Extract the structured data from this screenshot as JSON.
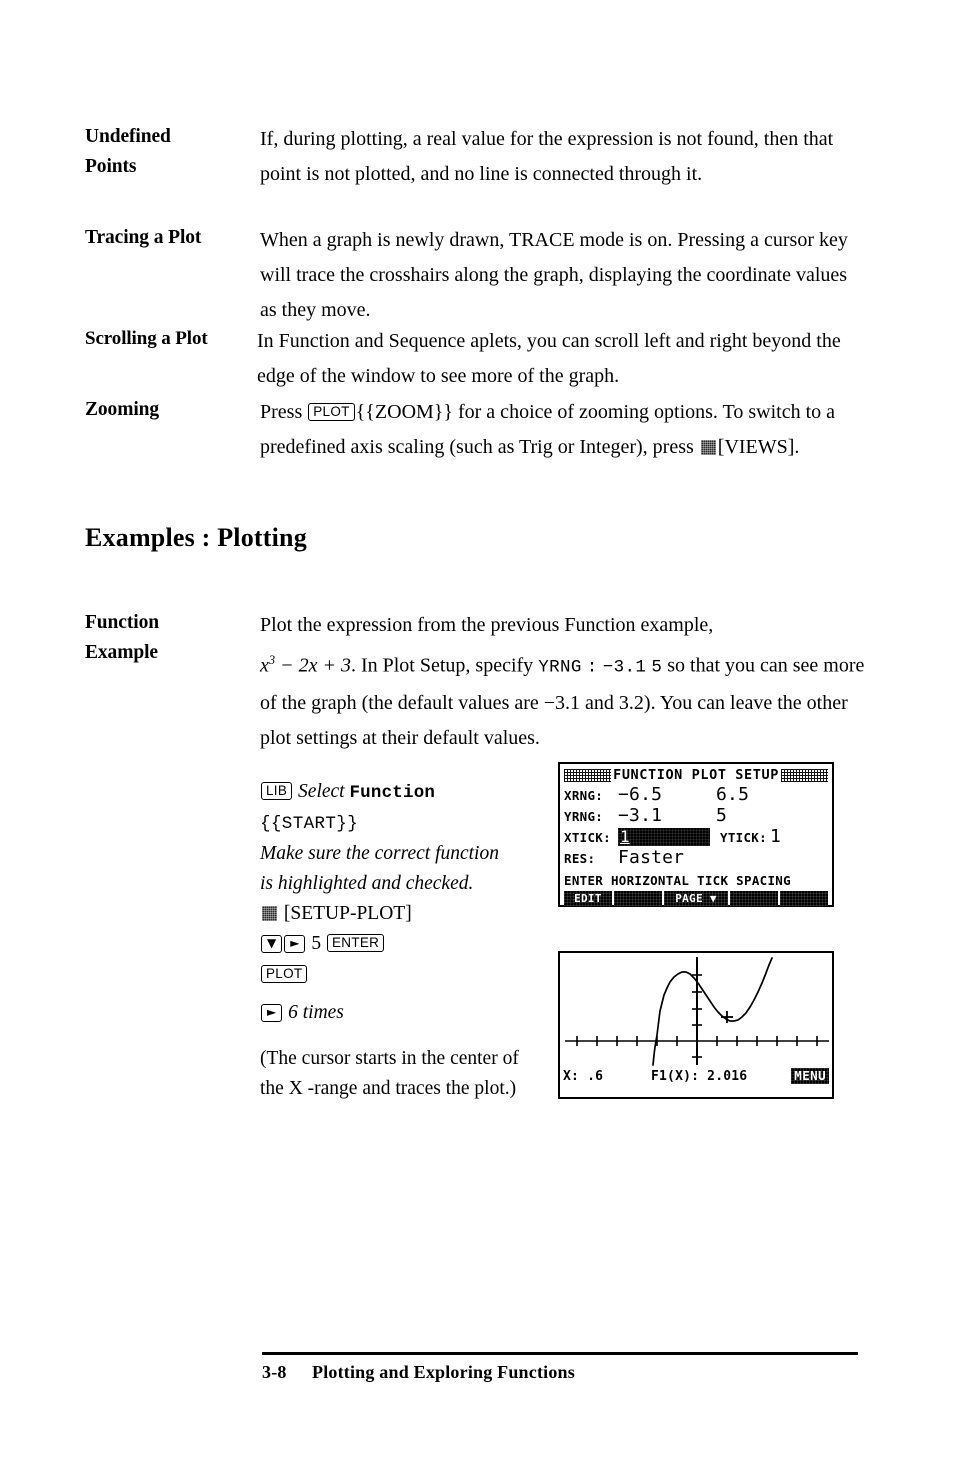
{
  "sections": [
    {
      "term_line1": "Undefined",
      "term_line2": "Points",
      "body": "If, during plotting, a real value for the expression is not found, then that point is not plotted, and no line is connected through it."
    },
    {
      "term_line1": "Tracing a Plot",
      "term_line2": "",
      "body": "When a graph is newly drawn, TRACE mode is on. Pressing a cursor key will trace the crosshairs along the graph, displaying the coordinate values as they move."
    },
    {
      "term_line1": "Scrolling a Plot",
      "term_line2": "",
      "body": "In Function and Sequence aplets, you can scroll left and right beyond the edge of the window to see more of the graph."
    }
  ],
  "zooming": {
    "term": "Zooming",
    "text_1": "Press",
    "key_plot": "PLOT",
    "text_2": "{{ZOOM}} for a choice of zooming options. To switch to a predefined axis scaling (such as Trig or Integer), press",
    "shift_key_icon": "shift-key",
    "key_views": "[VIEWS]",
    "text_3": "."
  },
  "heading": "Examples : Plotting",
  "function_example": {
    "term_line1": "Function",
    "term_line2": "Example",
    "text_1": "Plot the expression from the previous Function example,",
    "expr_base": "x",
    "expr_exponent": "3",
    "expr_rest": "− 2x + 3",
    "text_2": ". In Plot Setup, specify",
    "mono_yrng": "YRNG",
    "mono_colon": ":",
    "mono_low": "−3.1",
    "mono_high": "5",
    "text_so": "so",
    "text_3": "that you can see more of the graph (the default values are −3.1 and 3.2). You can leave the other plot settings at their default values."
  },
  "keysteps": {
    "line1_key": "LIB",
    "line1_italic": "Select",
    "line1_mono": "Function",
    "line2_mono": "{{START}}",
    "line3_italic": "Make sure the correct function",
    "line4_italic": "is highlighted and checked.",
    "line5_shift": "shift-key",
    "line5_label": "[SETUP-PLOT]",
    "line6_down": "▼",
    "line6_right": "►",
    "line6_digit": "5",
    "line6_enter": "ENTER"
  },
  "keysteps2": {
    "line1_key": "PLOT",
    "line2_right": "►",
    "line2_italic": "6 times",
    "note": "(The cursor starts in the center of the X -range and traces the plot.)"
  },
  "lcd_setup": {
    "title": "FUNCTION PLOT SETUP",
    "fields": [
      {
        "label": "XRNG:",
        "value_a": "−6.5",
        "value_b": "6.5"
      },
      {
        "label": "YRNG:",
        "value_a": "−3.1",
        "value_b": "5"
      }
    ],
    "xtick_label": "XTICK:",
    "xtick_value": "1",
    "ytick_label": "YTICK:",
    "ytick_value": "1",
    "res_label": "RES:",
    "res_value": "Faster",
    "status": "ENTER HORIZONTAL TICK SPACING",
    "softkeys": [
      "EDIT",
      "",
      "PAGE ▼",
      "",
      ""
    ]
  },
  "lcd_graph": {
    "x_label": "X: .6",
    "f_label": "F1(X): 2.016",
    "menu_label": "MENU"
  },
  "chart_data": {
    "type": "line",
    "title": "Function plot of x^3 - 2x + 3",
    "expression": "x^3 - 2x + 3",
    "xlabel": "X",
    "ylabel": "F1(X)",
    "xlim": [
      -6.5,
      6.5
    ],
    "ylim": [
      -3.1,
      5
    ],
    "xtick": 1,
    "ytick": 1,
    "grid": false,
    "cursor": {
      "x": 0.6,
      "y": 2.016
    },
    "x": [
      -2.2,
      -2.0,
      -1.8,
      -1.6,
      -1.4,
      -1.2,
      -1.0,
      -0.8,
      -0.6,
      -0.4,
      -0.2,
      0.0,
      0.2,
      0.4,
      0.6,
      0.8,
      1.0,
      1.2,
      1.4,
      1.6,
      1.8,
      2.0
    ],
    "y": [
      -3.25,
      -1.0,
      0.77,
      2.11,
      3.06,
      3.67,
      4.0,
      4.09,
      3.98,
      3.74,
      3.39,
      3.0,
      2.61,
      2.26,
      2.02,
      1.91,
      2.0,
      2.33,
      2.94,
      3.9,
      5.23,
      7.0
    ]
  },
  "footer": {
    "page": "3-8",
    "title": "Plotting and Exploring Functions"
  }
}
